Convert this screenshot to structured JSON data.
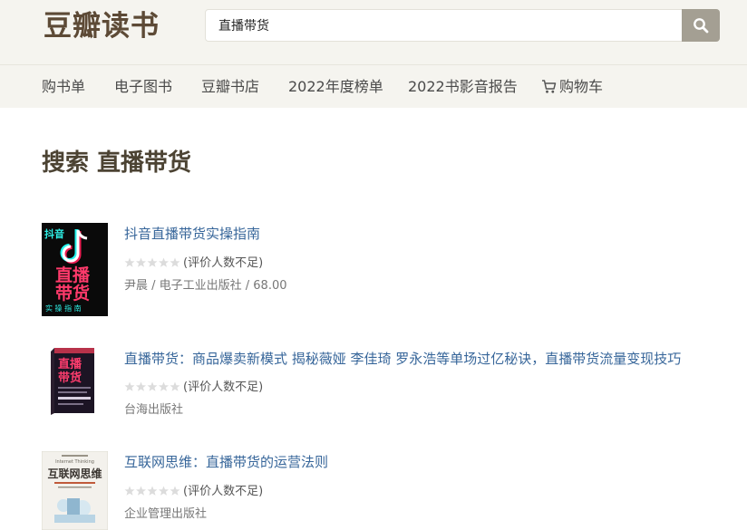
{
  "header": {
    "logo": "豆瓣读书",
    "search": {
      "value": "直播带货",
      "placeholder": ""
    }
  },
  "nav": {
    "items": [
      "购书单",
      "电子图书",
      "豆瓣书店",
      "2022年度榜单",
      "2022书影音报告",
      "购物车"
    ]
  },
  "page": {
    "title": "搜索 直播带货"
  },
  "results": [
    {
      "title": "抖音直播带货实操指南",
      "rating_text": "(评价人数不足)",
      "meta": "尹晨 / 电子工业出版社 / 68.00",
      "cover_text": {
        "brand": "抖音",
        "line1": "直播",
        "line2": "带货",
        "line3": "实 操 指 南"
      }
    },
    {
      "title": "直播带货：商品爆卖新模式 揭秘薇娅 李佳琦 罗永浩等单场过亿秘诀，直播带货流量变现技巧",
      "rating_text": "(评价人数不足)",
      "meta": "台海出版社",
      "cover_text": {
        "line1": "直播",
        "line2": "带货"
      }
    },
    {
      "title": "互联网思维：直播带货的运营法则",
      "rating_text": "(评价人数不足)",
      "meta": "企业管理出版社",
      "cover_text": {
        "line1": "Internet Thinking",
        "line2": "互联网思维"
      }
    }
  ],
  "colors": {
    "header_bg": "#f5f4ef",
    "logo": "#5d4a36",
    "link": "#37669a",
    "search_button": "#a49f93"
  }
}
